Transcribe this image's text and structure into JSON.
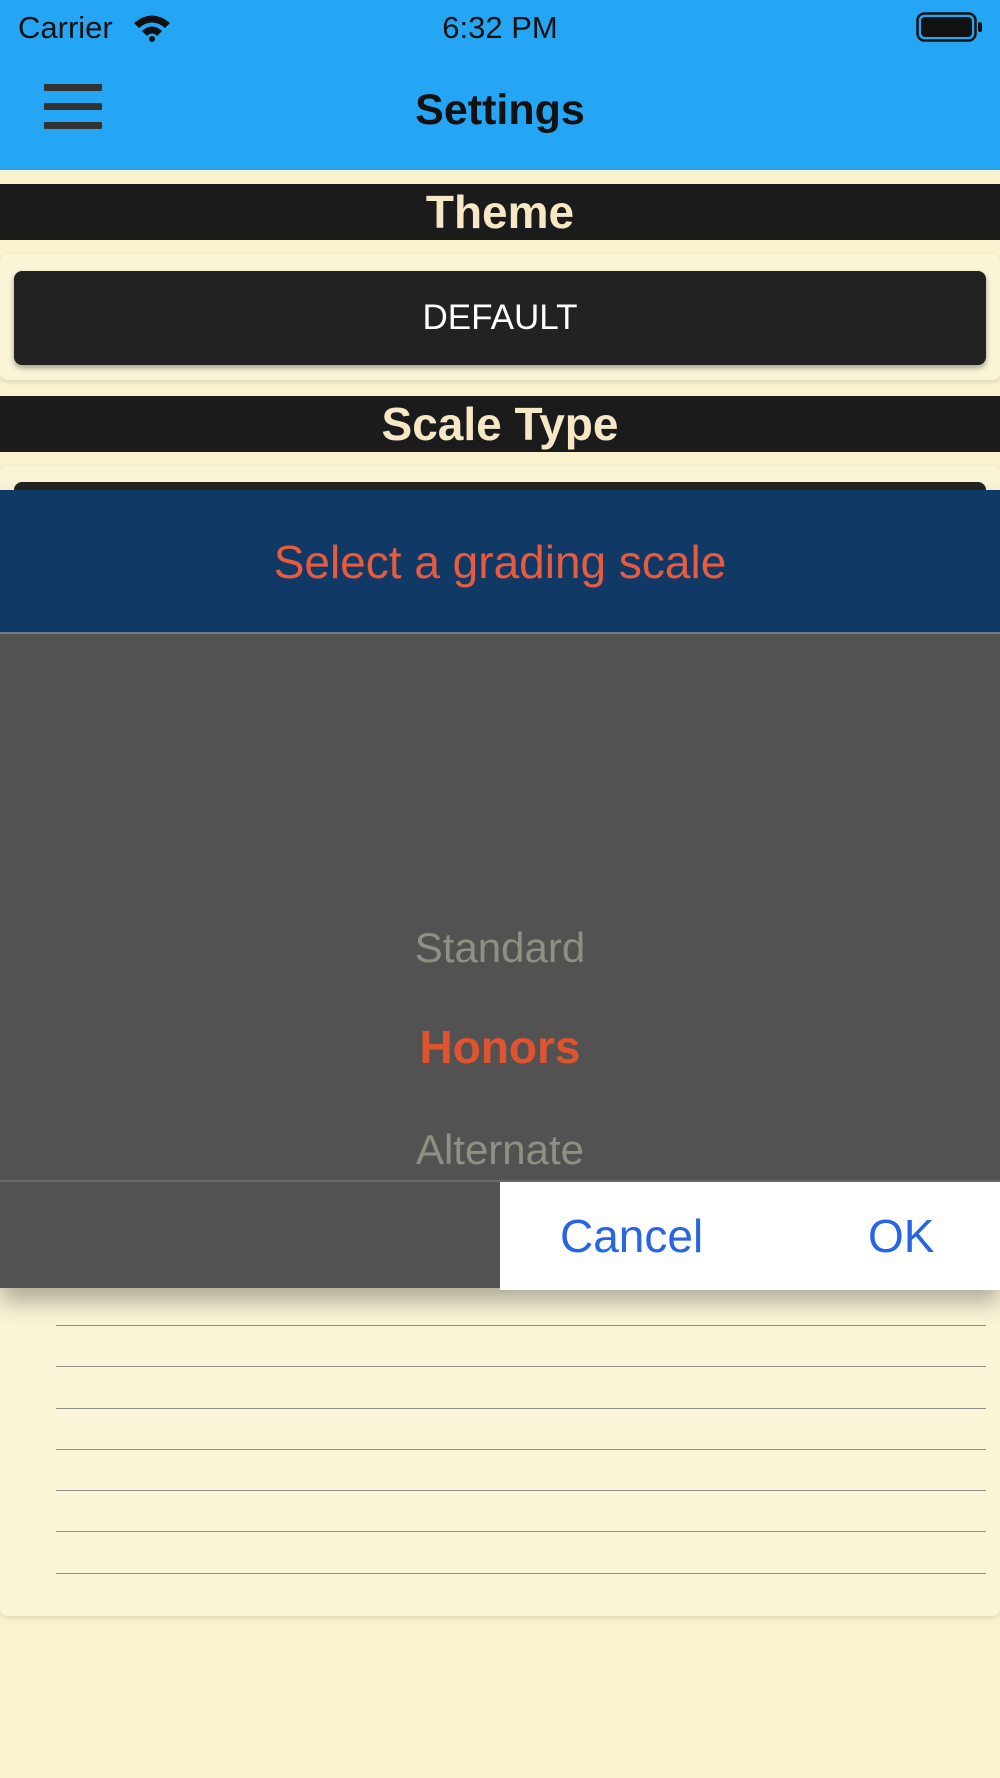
{
  "status_bar": {
    "carrier": "Carrier",
    "time": "6:32 PM",
    "wifi_icon": "wifi-icon",
    "battery_icon": "battery-full-icon"
  },
  "nav": {
    "title": "Settings",
    "menu_icon": "hamburger-menu-icon"
  },
  "theme": {
    "header": "Theme",
    "button_label": "DEFAULT"
  },
  "scale_type": {
    "header": "Scale Type"
  },
  "dialog": {
    "title": "Select a grading scale",
    "options": [
      "Standard",
      "Honors",
      "Alternate"
    ],
    "selected": "Honors",
    "cancel_label": "Cancel",
    "ok_label": "OK"
  },
  "colors": {
    "nav_bar": "#25a6f5",
    "page_background": "#faf2cf",
    "section_header": "#1b1b1b",
    "dialog_title_bg": "#113965",
    "dialog_accent": "#e0532f",
    "picker_bg": "#525252",
    "button_text": "#2765e2"
  }
}
